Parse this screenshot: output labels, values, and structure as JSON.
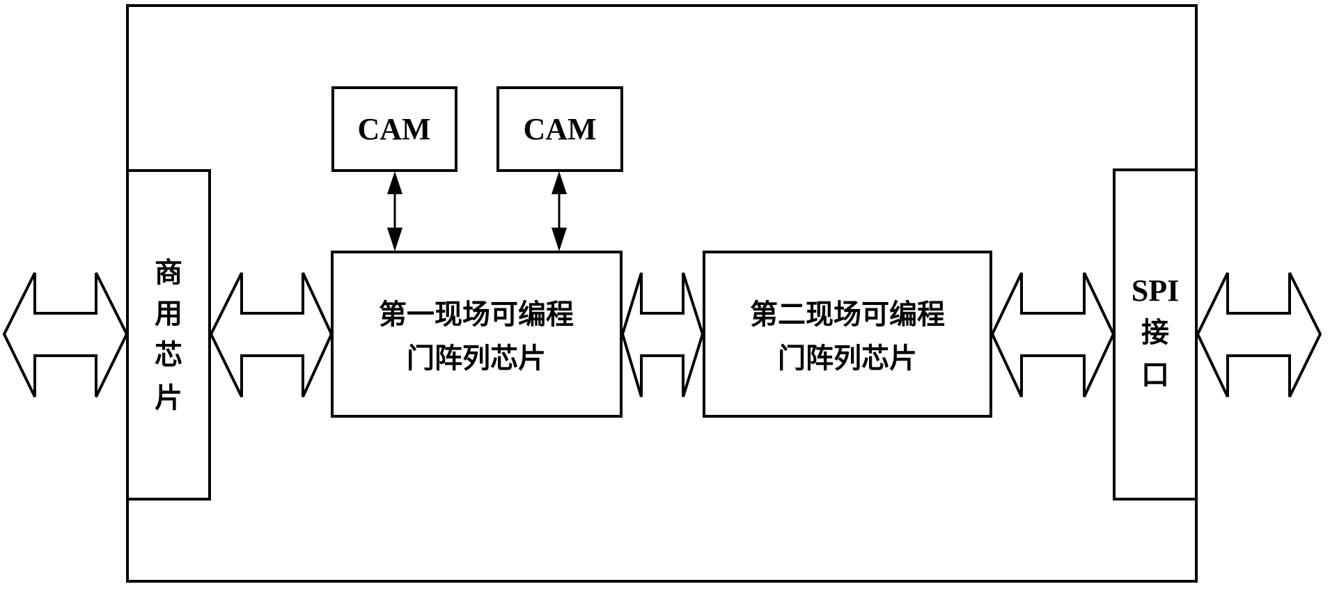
{
  "diagram": {
    "type": "block-diagram",
    "colors": {
      "stroke": "#000000",
      "fill": "#ffffff"
    },
    "commercial_chip": {
      "label_chars": [
        "商",
        "用",
        "芯",
        "片"
      ]
    },
    "cam_blocks": [
      {
        "label": "CAM"
      },
      {
        "label": "CAM"
      }
    ],
    "fpga_first": {
      "line1": "第一现场可编程",
      "line2": "门阵列芯片"
    },
    "fpga_second": {
      "line1": "第二现场可编程",
      "line2": "门阵列芯片"
    },
    "spi_interface": {
      "line1": "SPI",
      "chars": [
        "接",
        "口"
      ]
    },
    "connections": [
      {
        "from": "external-left",
        "to": "commercial-chip",
        "kind": "bidirectional-bus"
      },
      {
        "from": "commercial-chip",
        "to": "fpga-first",
        "kind": "bidirectional-bus"
      },
      {
        "from": "fpga-first",
        "to": "fpga-second",
        "kind": "bidirectional-bus"
      },
      {
        "from": "fpga-second",
        "to": "spi-interface",
        "kind": "bidirectional-bus"
      },
      {
        "from": "spi-interface",
        "to": "external-right",
        "kind": "bidirectional-bus"
      },
      {
        "from": "cam-1",
        "to": "fpga-first",
        "kind": "bidirectional-line"
      },
      {
        "from": "cam-2",
        "to": "fpga-first",
        "kind": "bidirectional-line"
      }
    ]
  }
}
